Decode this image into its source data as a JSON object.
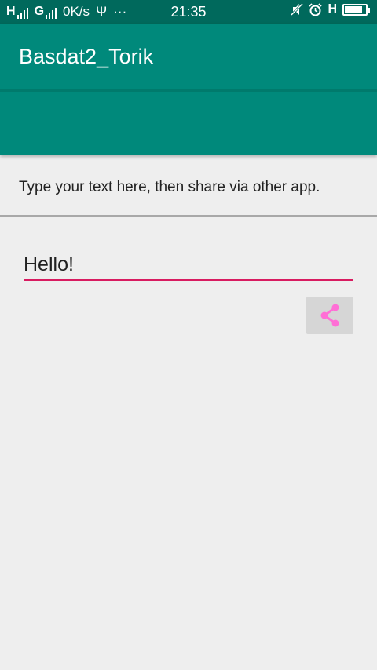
{
  "status_bar": {
    "sim1_label": "H",
    "sim2_label": "G",
    "speed": "0K/s",
    "usb_glyph": "Ψ",
    "more": "···",
    "time": "21:35",
    "network_label": "H",
    "battery_level": 0.8
  },
  "app_bar": {
    "title": "Basdat2_Torik",
    "color": "#00897b"
  },
  "instruction": {
    "text": "Type your text here, then share via other app."
  },
  "text_field": {
    "value": "Hello!",
    "underline_color": "#d81b60"
  },
  "share_button": {
    "icon": "share-icon",
    "icon_color": "#ff6fd6"
  }
}
